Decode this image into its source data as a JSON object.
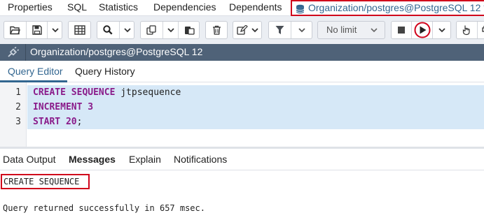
{
  "top_tabs": {
    "properties": "Properties",
    "sql": "SQL",
    "statistics": "Statistics",
    "dependencies": "Dependencies",
    "dependents": "Dependents",
    "query_tool": "Organization/postgres@PostgreSQL 12 *"
  },
  "toolbar": {
    "row_limit": "No limit"
  },
  "connection": {
    "label": "Organization/postgres@PostgreSQL 12"
  },
  "editor_tabs": {
    "query_editor": "Query Editor",
    "query_history": "Query History"
  },
  "editor": {
    "lines": [
      {
        "number": "1",
        "kw": "CREATE SEQUENCE",
        "rest": " jtpsequence"
      },
      {
        "number": "2",
        "kw": "INCREMENT",
        "num": "3"
      },
      {
        "number": "3",
        "kw": "START",
        "num": "20",
        "punct": ";"
      }
    ]
  },
  "output_tabs": {
    "data_output": "Data Output",
    "messages": "Messages",
    "explain": "Explain",
    "notifications": "Notifications"
  },
  "messages": {
    "result": "CREATE SEQUENCE",
    "status": "Query returned successfully in 657 msec."
  },
  "colors": {
    "highlight_border": "#d0021b",
    "accent": "#326690",
    "connection_bar": "#4f6278",
    "line_highlight": "#d6e8f7",
    "keyword": "#8a1b8a"
  },
  "icons": [
    "database-icon",
    "open-folder-icon",
    "save-icon",
    "find-icon",
    "copy-icon",
    "paste-icon",
    "delete-icon",
    "edit-icon",
    "filter-icon",
    "stop-icon",
    "execute-icon",
    "explain-icon",
    "plug-icon"
  ]
}
